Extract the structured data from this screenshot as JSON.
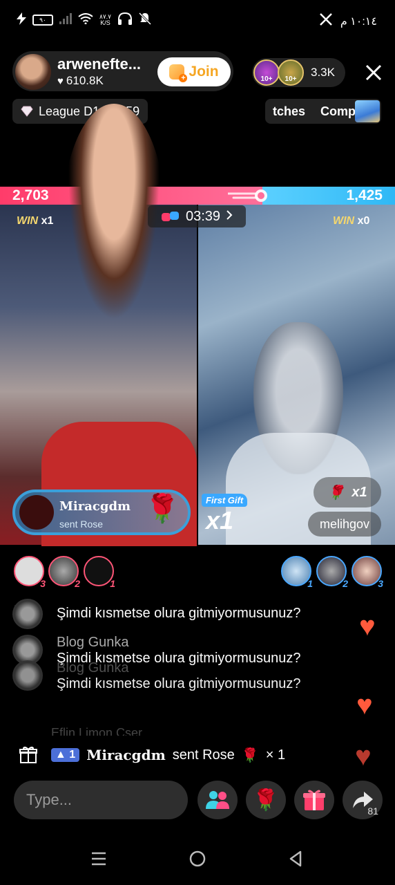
{
  "status_bar": {
    "network_speed": "٨٧.٧\nK/S",
    "battery": "٩٠",
    "time": "١٠:١٤ م",
    "icons": [
      "charging-icon",
      "signal-icon",
      "wifi-icon",
      "headphones-icon",
      "mute-icon",
      "x-app-icon"
    ]
  },
  "host": {
    "name": "arwenefte...",
    "likes": "610.8K",
    "join_label": "Join",
    "viewer_count": "3.3K",
    "viewer_badges": [
      "10+",
      "10+"
    ]
  },
  "league": {
    "label": "League D1 No. 59"
  },
  "ticker": {
    "items": [
      "tches",
      "Comp"
    ]
  },
  "battle": {
    "score_left": "2,703",
    "score_right": "1,425",
    "timer": "03:39",
    "win_label": "WIN",
    "win_left": "x1",
    "win_right": "x0"
  },
  "gift_card": {
    "user": "Miracgdm",
    "label": "sent Rose",
    "first_gift_label": "First Gift",
    "multiplier": "x1"
  },
  "opponent": {
    "rose_multiplier": "x1",
    "username": "melihgov"
  },
  "supporters_left": [
    {
      "rank": "3",
      "color": "#ff5577"
    },
    {
      "rank": "2",
      "color": "#ff5577"
    },
    {
      "rank": "1",
      "color": "#ff5577"
    }
  ],
  "supporters_right": [
    {
      "rank": "1",
      "color": "#4aa8ff"
    },
    {
      "rank": "2",
      "color": "#4aa8ff"
    },
    {
      "rank": "3",
      "color": "#4aa8ff"
    }
  ],
  "chat": {
    "faded_top": "...",
    "messages": [
      {
        "name": "",
        "text": "Şimdi kısmetse olura gitmiyormusunuz?"
      },
      {
        "name": "Blog Gunka",
        "text": "Şimdi kısmetse olura gitmiyormusunuz?"
      },
      {
        "name": "Blog Gunka",
        "text": "Şimdi kısmetse olura gitmiyormusunuz?"
      }
    ],
    "faded_bottom": "Eflin Limon Cser"
  },
  "gift_notice": {
    "level": "1",
    "user": "Miracgdm",
    "text": "sent Rose",
    "multiplier": "× 1"
  },
  "composer": {
    "placeholder": "Type...",
    "share_count": "81"
  },
  "colors": {
    "red_team": "#ff3c6a",
    "blue_team": "#2fb8f5",
    "join_text": "#f5a623",
    "heart": "#ff5a3c"
  }
}
